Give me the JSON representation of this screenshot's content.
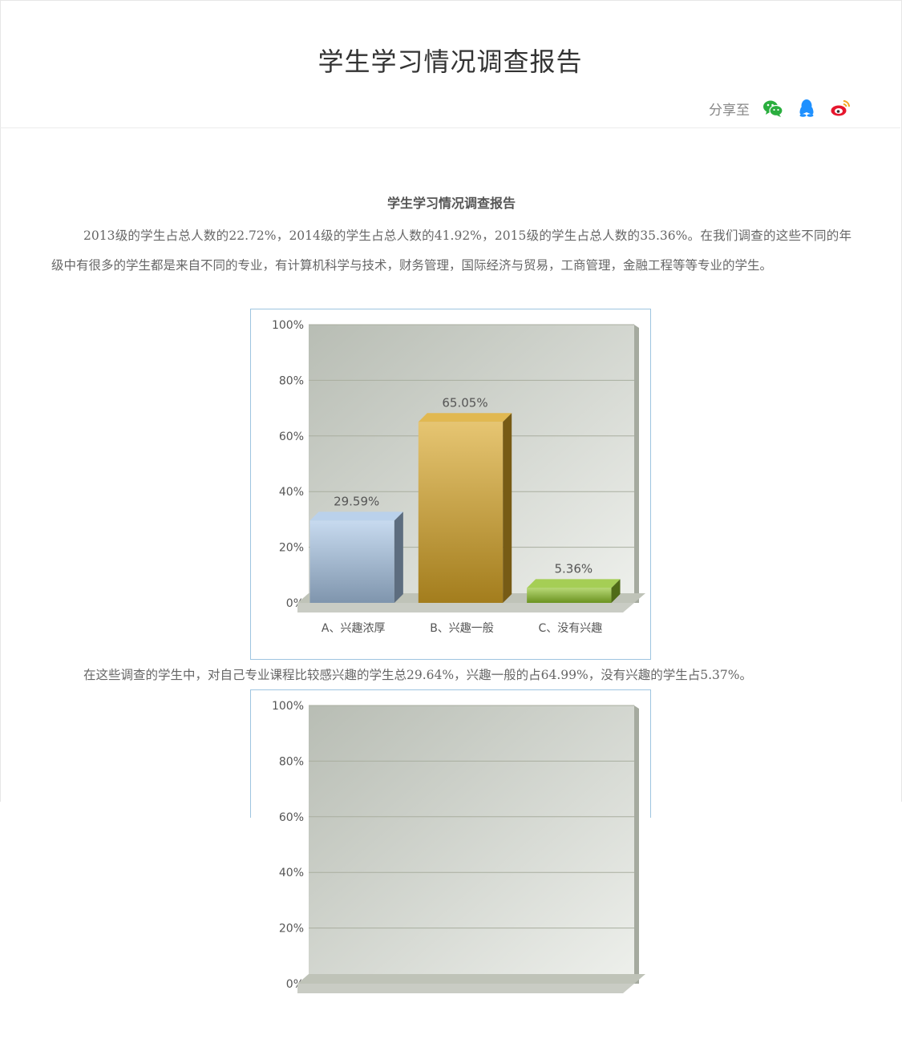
{
  "page": {
    "title": "学生学习情况调查报告"
  },
  "share": {
    "label": "分享至",
    "icons": [
      "wechat-icon",
      "qq-icon",
      "weibo-icon"
    ],
    "colors": {
      "wechat": "#2aae3e",
      "qq": "#1e90ff",
      "weibo": "#e6162d"
    }
  },
  "article": {
    "heading": "学生学习情况调查报告",
    "paragraph1": "2013级的学生占总人数的22.72%，2014级的学生占总人数的41.92%，2015级的学生占总人数的35.36%。在我们调查的这些不同的年级中有很多的学生都是来自不同的专业，有计算机科学与技术，财务管理，国际经济与贸易，工商管理，金融工程等等专业的学生。",
    "caption1": "在这些调查的学生中，对自己专业课程比较感兴趣的学生总29.64%，兴趣一般的占64.99%，没有兴趣的学生占5.37%。"
  },
  "chart_data": [
    {
      "type": "bar",
      "categories": [
        "A、兴趣浓厚",
        "B、兴趣一般",
        "C、没有兴趣"
      ],
      "values": [
        29.59,
        65.05,
        5.36
      ],
      "data_labels": [
        "29.59%",
        "65.05%",
        "5.36%"
      ],
      "ylim": [
        0,
        100
      ],
      "y_ticks": [
        "0%",
        "20%",
        "40%",
        "60%",
        "80%",
        "100%"
      ],
      "colors": [
        "#a9c6e6",
        "#d9a626",
        "#8fc22a"
      ],
      "grid": true
    },
    {
      "type": "bar",
      "ylim": [
        0,
        100
      ],
      "y_ticks": [
        "0%",
        "20%",
        "40%",
        "60%",
        "80%",
        "100%"
      ],
      "grid": true
    }
  ]
}
